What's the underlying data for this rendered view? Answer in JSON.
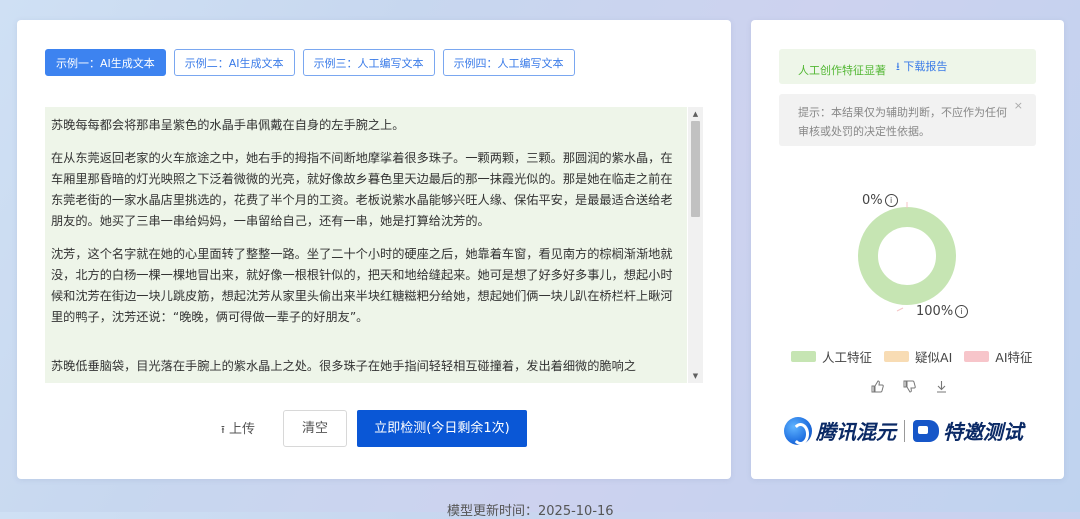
{
  "tabs": [
    {
      "label": "示例一：AI生成文本",
      "active": true
    },
    {
      "label": "示例二：AI生成文本",
      "active": false
    },
    {
      "label": "示例三：人工编写文本",
      "active": false
    },
    {
      "label": "示例四：人工编写文本",
      "active": false
    }
  ],
  "text_input": {
    "paragraphs": [
      "苏晚每每都会将那串呈紫色的水晶手串佩戴在自身的左手腕之上。",
      "在从东莞返回老家的火车旅途之中，她右手的拇指不间断地摩挲着很多珠子。一颗两颗，三颗。那圆润的紫水晶，在车厢里那昏暗的灯光映照之下泛着微微的光亮，就好像故乡暮色里天边最后的那一抹霞光似的。那是她在临走之前在东莞老街的一家水晶店里挑选的，花费了半个月的工资。老板说紫水晶能够兴旺人缘、保佑平安，是最最适合送给老朋友的。她买了三串一串给妈妈，一串留给自己，还有一串，她是打算给沈芳的。",
      "沈芳，这个名字就在她的心里面转了整整一路。坐了二十个小时的硬座之后，她靠着车窗，看见南方的棕榈渐渐地就没，北方的白杨一棵一棵地冒出来，就好像一根根针似的，把天和地给缝起来。她可是想了好多好多事儿，想起小时候和沈芳在街边一块儿跳皮筋，想起沈芳从家里头偷出来半块红糖糍粑分给她，想起她们俩一块儿趴在桥栏杆上瞅河里的鸭子，沈芳还说：“晚晚，俩可得做一辈子的好朋友”。",
      "苏晚低垂脑袋，目光落在手腕上的紫水晶上之处。很多珠子在她手指间轻轻相互碰撞着，发出着细微的脆响之"
    ]
  },
  "actions": {
    "upload_label": "上传",
    "clear_label": "清空",
    "detect_label": "立即检测(今日剩余1次)"
  },
  "result": {
    "title": "人工创作特征显著",
    "download_label": "下载报告",
    "tip": "提示：本结果仅为辅助判断，不应作为任何审核或处罚的决定性依据。",
    "tip_close": "×",
    "pct_ai": "0%",
    "pct_human": "100%",
    "human_fraction": 1.0,
    "ai_fraction": 0.0,
    "legend": [
      {
        "label": "人工特征",
        "color": "#c6e5b3"
      },
      {
        "label": "疑似AI",
        "color": "#f8dcb4"
      },
      {
        "label": "AI特征",
        "color": "#f7c5ca"
      }
    ]
  },
  "brand": {
    "name_a": "腾讯混元",
    "name_b": "特邀测试"
  },
  "footer": {
    "model_updated": "模型更新时间：2025-10-16"
  },
  "icons": {
    "upload": "upload-icon",
    "download": "download-icon",
    "info": "info-icon",
    "like": "thumbs-up-icon",
    "dislike": "thumbs-down-icon",
    "save": "download-arrow-icon"
  }
}
